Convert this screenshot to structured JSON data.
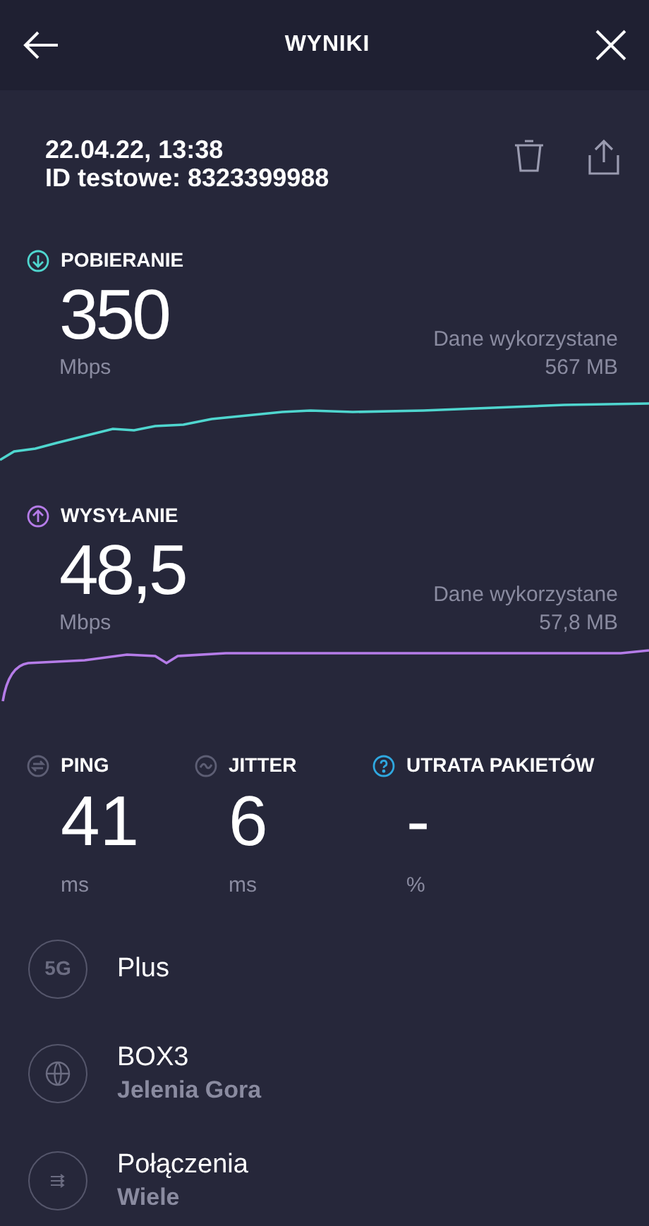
{
  "header": {
    "title": "WYNIKI"
  },
  "test": {
    "date": "22.04.22, 13:38",
    "id": "ID testowe: 8323399988"
  },
  "speeds": [
    {
      "kind": "download",
      "label": "POBIERANIE",
      "value": "350",
      "unit": "Mbps",
      "data_label": "Dane wykorzystane",
      "data_value": "567 MB",
      "color": "#4fd6cf"
    },
    {
      "kind": "upload",
      "label": "WYSYŁANIE",
      "value": "48,5",
      "unit": "Mbps",
      "data_label": "Dane wykorzystane",
      "data_value": "57,8 MB",
      "color": "#b57ce8"
    }
  ],
  "metrics": [
    {
      "kind": "ping",
      "label": "PING",
      "value": "41",
      "unit": "ms"
    },
    {
      "kind": "jitter",
      "label": "JITTER",
      "value": "6",
      "unit": "ms"
    },
    {
      "kind": "loss",
      "label": "UTRATA PAKIETÓW",
      "value": "-",
      "unit": "%"
    }
  ],
  "details": [
    {
      "kind": "network",
      "icon_text": "5G",
      "title": "Plus"
    },
    {
      "kind": "server",
      "title": "BOX3",
      "subtitle": "Jelenia Gora"
    },
    {
      "kind": "connections",
      "title": "Połączenia",
      "subtitle": "Wiele"
    }
  ]
}
